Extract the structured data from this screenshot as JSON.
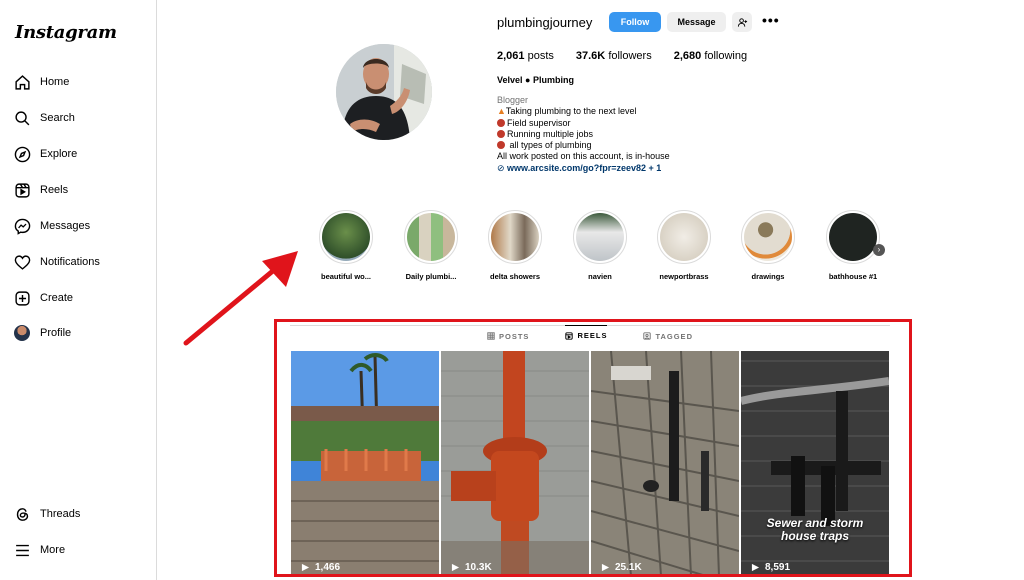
{
  "app": {
    "logo": "Instagram"
  },
  "sidebar": {
    "items": [
      {
        "label": "Home",
        "icon": "home-icon"
      },
      {
        "label": "Search",
        "icon": "search-icon"
      },
      {
        "label": "Explore",
        "icon": "compass-icon"
      },
      {
        "label": "Reels",
        "icon": "reels-icon"
      },
      {
        "label": "Messages",
        "icon": "messenger-icon"
      },
      {
        "label": "Notifications",
        "icon": "heart-icon"
      },
      {
        "label": "Create",
        "icon": "plus-square-icon"
      },
      {
        "label": "Profile",
        "icon": "avatar"
      }
    ],
    "bottom": [
      {
        "label": "Threads",
        "icon": "threads-icon"
      },
      {
        "label": "More",
        "icon": "menu-icon"
      }
    ]
  },
  "profile": {
    "username": "plumbingjourney",
    "follow_label": "Follow",
    "message_label": "Message",
    "posts_count": "2,061",
    "posts_label": "posts",
    "followers_count": "37.6K",
    "followers_label": "followers",
    "following_count": "2,680",
    "following_label": "following",
    "display_name": "Velvel ● Plumbing",
    "category": "Blogger",
    "bio_lines": [
      "Taking plumbing to the next level",
      "Field supervisor",
      "Running multiple jobs",
      " all types of plumbing",
      "All work posted on this account, is in-house"
    ],
    "link": "www.arcsite.com/go?fpr=zeev82 + 1"
  },
  "highlights": [
    "beautiful wo...",
    "Daily plumbi...",
    "delta showers",
    "navien",
    "newportbrass",
    "drawings",
    "bathhouse #1"
  ],
  "tabs": [
    "POSTS",
    "REELS",
    "TAGGED"
  ],
  "active_tab": "REELS",
  "reels": [
    {
      "views": "1,466"
    },
    {
      "views": "10.3K"
    },
    {
      "views": "25.1K"
    },
    {
      "views": "8,591",
      "caption_line1": "Sewer and storm",
      "caption_line2": "house traps"
    }
  ],
  "colors": {
    "follow_button": "#3897f0",
    "annotation_red": "#e0141b"
  }
}
